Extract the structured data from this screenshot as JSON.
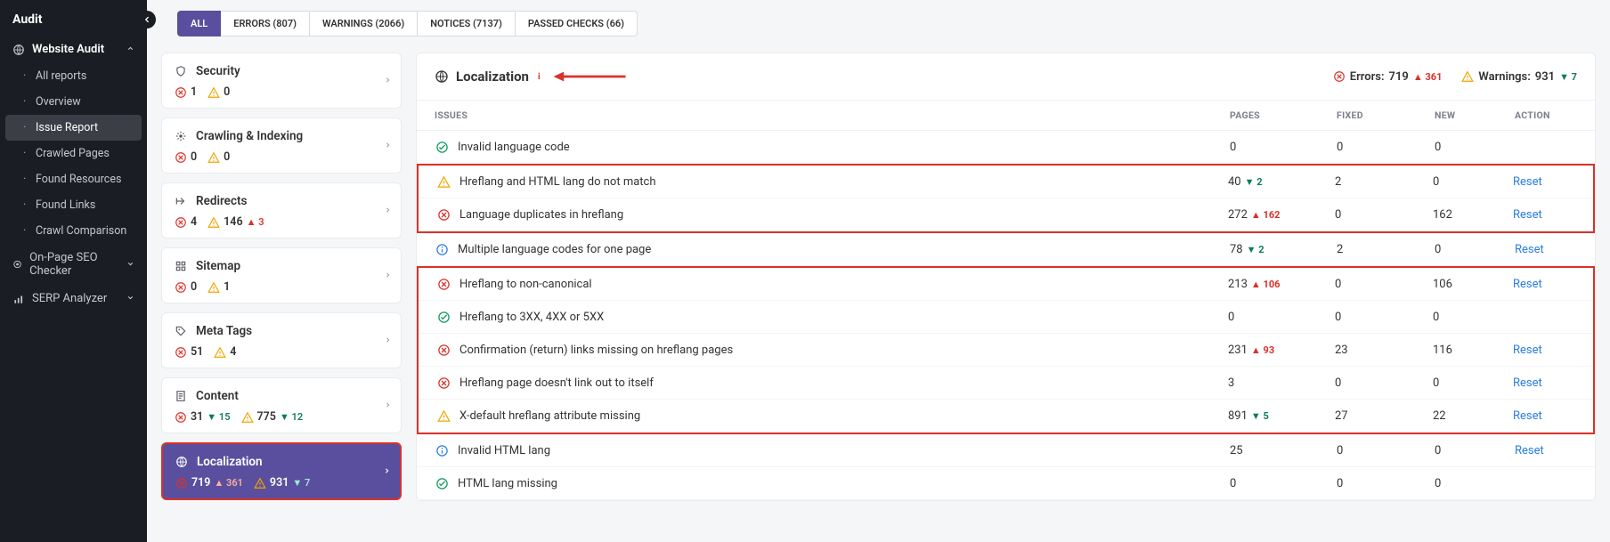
{
  "sidebar": {
    "title": "Audit",
    "sections": {
      "audit_label": "Website Audit",
      "audit_items": [
        "All reports",
        "Overview",
        "Issue Report",
        "Crawled Pages",
        "Found Resources",
        "Found Links",
        "Crawl Comparison"
      ],
      "onpage_label": "On-Page SEO Checker",
      "serp_label": "SERP Analyzer"
    }
  },
  "filters": {
    "all": "ALL",
    "errors": "ERRORS (807)",
    "warnings": "WARNINGS (2066)",
    "notices": "NOTICES (7137)",
    "passed": "PASSED CHECKS (66)"
  },
  "categories": [
    {
      "name": "Security",
      "icon": "shield",
      "err": "1",
      "err_d": "",
      "warn": "0",
      "warn_d": ""
    },
    {
      "name": "Crawling & Indexing",
      "icon": "crawl",
      "err": "0",
      "err_d": "",
      "warn": "0",
      "warn_d": ""
    },
    {
      "name": "Redirects",
      "icon": "redirect",
      "err": "4",
      "err_d": "",
      "warn": "146",
      "warn_d": "▲ 3"
    },
    {
      "name": "Sitemap",
      "icon": "sitemap",
      "err": "0",
      "err_d": "",
      "warn": "1",
      "warn_d": ""
    },
    {
      "name": "Meta Tags",
      "icon": "tag",
      "err": "51",
      "err_d": "",
      "warn": "4",
      "warn_d": ""
    },
    {
      "name": "Content",
      "icon": "content",
      "err": "31",
      "err_d": "▼ 15",
      "warn": "775",
      "warn_d": "▼ 12"
    },
    {
      "name": "Localization",
      "icon": "globe",
      "err": "719",
      "err_d": "▲ 361",
      "warn": "931",
      "warn_d": "▼ 7",
      "active": true
    }
  ],
  "panel": {
    "title": "Localization",
    "err_label": "Errors:",
    "err_count": "719",
    "err_delta": "▲ 361",
    "warn_label": "Warnings:",
    "warn_count": "931",
    "warn_delta": "▼ 7"
  },
  "table": {
    "headers": {
      "issues": "ISSUES",
      "pages": "PAGES",
      "fixed": "FIXED",
      "new": "NEW",
      "action": "ACTION"
    },
    "reset_label": "Reset"
  },
  "issues": [
    {
      "type": "ok",
      "name": "Invalid language code",
      "pages": "0",
      "pd": "",
      "fixed": "0",
      "new": "0",
      "reset": false,
      "hl": 0
    },
    {
      "type": "warn",
      "name": "Hreflang and HTML lang do not match",
      "pages": "40",
      "pd": "▼ 2",
      "fixed": "2",
      "new": "0",
      "reset": true,
      "hl": 1
    },
    {
      "type": "err",
      "name": "Language duplicates in hreflang",
      "pages": "272",
      "pd": "▲ 162",
      "fixed": "0",
      "new": "162",
      "reset": true,
      "hl": 1
    },
    {
      "type": "info",
      "name": "Multiple language codes for one page",
      "pages": "78",
      "pd": "▼ 2",
      "fixed": "2",
      "new": "0",
      "reset": true,
      "hl": 0
    },
    {
      "type": "err",
      "name": "Hreflang to non-canonical",
      "pages": "213",
      "pd": "▲ 106",
      "fixed": "0",
      "new": "106",
      "reset": true,
      "hl": 2
    },
    {
      "type": "ok",
      "name": "Hreflang to 3XX, 4XX or 5XX",
      "pages": "0",
      "pd": "",
      "fixed": "0",
      "new": "0",
      "reset": false,
      "hl": 2
    },
    {
      "type": "err",
      "name": "Confirmation (return) links missing on hreflang pages",
      "pages": "231",
      "pd": "▲ 93",
      "fixed": "23",
      "new": "116",
      "reset": true,
      "hl": 2
    },
    {
      "type": "err",
      "name": "Hreflang page doesn't link out to itself",
      "pages": "3",
      "pd": "",
      "fixed": "0",
      "new": "0",
      "reset": true,
      "hl": 2
    },
    {
      "type": "warn",
      "name": "X-default hreflang attribute missing",
      "pages": "891",
      "pd": "▼ 5",
      "fixed": "27",
      "new": "22",
      "reset": true,
      "hl": 2
    },
    {
      "type": "info",
      "name": "Invalid HTML lang",
      "pages": "25",
      "pd": "",
      "fixed": "0",
      "new": "0",
      "reset": true,
      "hl": 0
    },
    {
      "type": "ok",
      "name": "HTML lang missing",
      "pages": "0",
      "pd": "",
      "fixed": "0",
      "new": "0",
      "reset": false,
      "hl": 0
    }
  ]
}
